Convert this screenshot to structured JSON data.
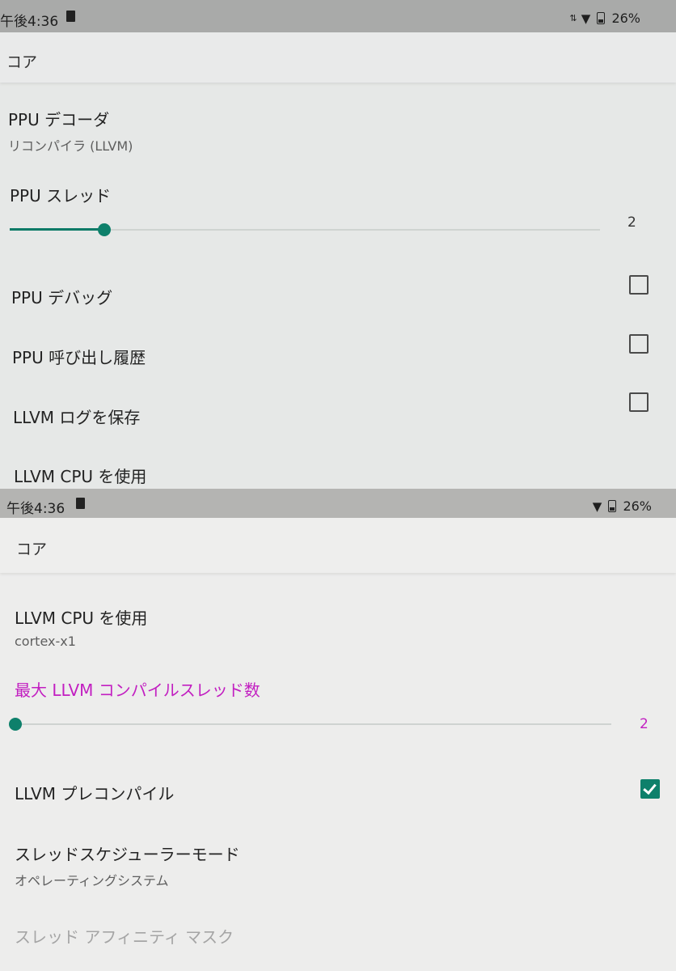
{
  "screen1": {
    "status": {
      "time": "午後4:36",
      "battery": "26%"
    },
    "appbar": {
      "title": "コア"
    },
    "ppu_decoder": {
      "title": "PPU デコーダ",
      "summary": "リコンパイラ (LLVM)"
    },
    "ppu_threads": {
      "title": "PPU スレッド",
      "value": "2",
      "fraction": 0.15
    },
    "ppu_debug": {
      "title": "PPU デバッグ",
      "checked": false
    },
    "ppu_call_history": {
      "title": "PPU 呼び出し履歴",
      "checked": false
    },
    "llvm_save_log": {
      "title": "LLVM ログを保存",
      "checked": false
    },
    "llvm_cpu": {
      "title": "LLVM CPU を使用"
    }
  },
  "screen2": {
    "status": {
      "time": "午後4:36",
      "battery": "26%"
    },
    "appbar": {
      "title": "コア"
    },
    "llvm_cpu": {
      "title": "LLVM CPU を使用",
      "summary": "cortex-x1"
    },
    "max_llvm_threads": {
      "title": "最大 LLVM コンパイルスレッド数",
      "value": "2",
      "fraction": 0.0
    },
    "llvm_precompile": {
      "title": "LLVM プレコンパイル",
      "checked": true
    },
    "thread_scheduler": {
      "title": "スレッドスケジューラーモード",
      "summary": "オペレーティングシステム"
    },
    "thread_affinity": {
      "title": "スレッド アフィニティ マスク"
    }
  },
  "colors": {
    "accent_teal": "#0e806b",
    "highlight_magenta": "#c21fc1"
  }
}
